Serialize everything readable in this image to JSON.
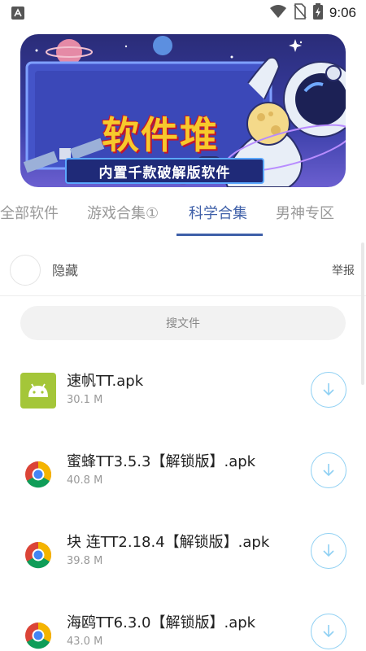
{
  "status_bar": {
    "time": "9:06",
    "icons": [
      "app-notification-icon",
      "wifi-icon",
      "no-sim-icon",
      "battery-charging-icon"
    ]
  },
  "banner": {
    "title": "软件堆",
    "subtitle": "内置千款破解版软件"
  },
  "tabs": [
    {
      "label": "全部软件",
      "active": false
    },
    {
      "label": "游戏合集①",
      "active": false
    },
    {
      "label": "科学合集",
      "active": true
    },
    {
      "label": "男神专区",
      "active": false
    }
  ],
  "group": {
    "name": "隐藏",
    "report_label": "举报"
  },
  "search": {
    "placeholder": "搜文件"
  },
  "files": [
    {
      "name": "速帆TT.apk",
      "size": "30.1 M",
      "icon": "android-icon"
    },
    {
      "name": "蜜蜂TT3.5.3【解锁版】.apk",
      "size": "40.8 M",
      "icon": "chrome-icon"
    },
    {
      "name": "块 连TT2.18.4【解锁版】.apk",
      "size": "39.8 M",
      "icon": "chrome-icon"
    },
    {
      "name": "海鸥TT6.3.0【解锁版】.apk",
      "size": "43.0 M",
      "icon": "chrome-icon"
    }
  ],
  "colors": {
    "accent": "#3e5fa8",
    "download_ring": "#8fd0f3",
    "android_green": "#a4c639"
  }
}
